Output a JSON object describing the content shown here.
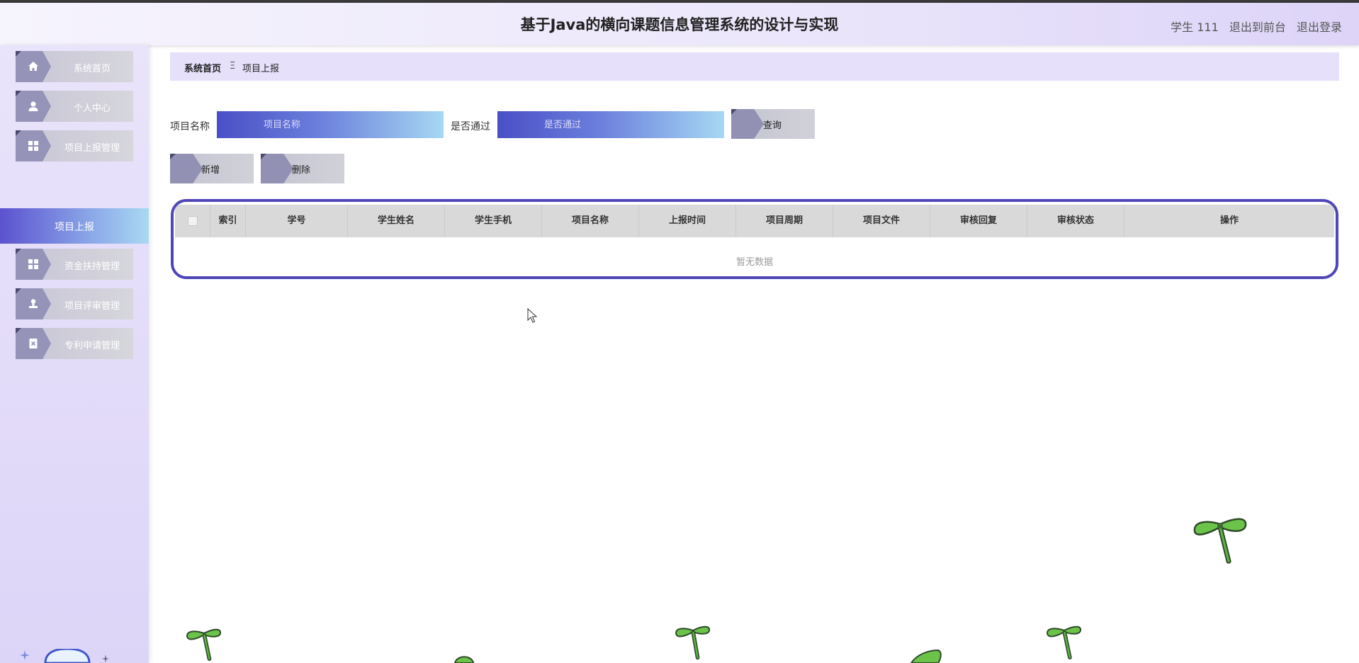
{
  "header": {
    "title": "基于Java的横向课题信息管理系统的设计与实现",
    "user": "学生 111",
    "frontend_link": "退出到前台",
    "logout_link": "退出登录"
  },
  "sidebar": {
    "items": [
      {
        "label": "系统首页",
        "icon": "home-icon"
      },
      {
        "label": "个人中心",
        "icon": "user-icon"
      },
      {
        "label": "项目上报管理",
        "icon": "grid-icon"
      },
      {
        "label": "项目上报",
        "icon": ""
      },
      {
        "label": "资金扶持管理",
        "icon": "grid-icon"
      },
      {
        "label": "项目评审管理",
        "icon": "stamp-icon"
      },
      {
        "label": "专利申请管理",
        "icon": "document-icon"
      }
    ]
  },
  "breadcrumb": {
    "home": "系统首页",
    "separator": "Ξ",
    "current": "项目上报"
  },
  "filters": {
    "name_label": "项目名称",
    "name_placeholder": "项目名称",
    "passed_label": "是否通过",
    "passed_placeholder": "是否通过",
    "query_button": "查询"
  },
  "actions": {
    "add_button": "新增",
    "delete_button": "删除"
  },
  "table": {
    "columns": [
      "索引",
      "学号",
      "学生姓名",
      "学生手机",
      "项目名称",
      "上报时间",
      "项目周期",
      "项目文件",
      "审核回复",
      "审核状态",
      "操作"
    ],
    "empty_text": "暂无数据"
  },
  "colors": {
    "accent": "#4f46b8",
    "header_bg": "#ece7fb",
    "sidebar_bg": "#e4ddf9",
    "active_menu_start": "#5b52cf",
    "active_menu_end": "#a9d9f2"
  }
}
